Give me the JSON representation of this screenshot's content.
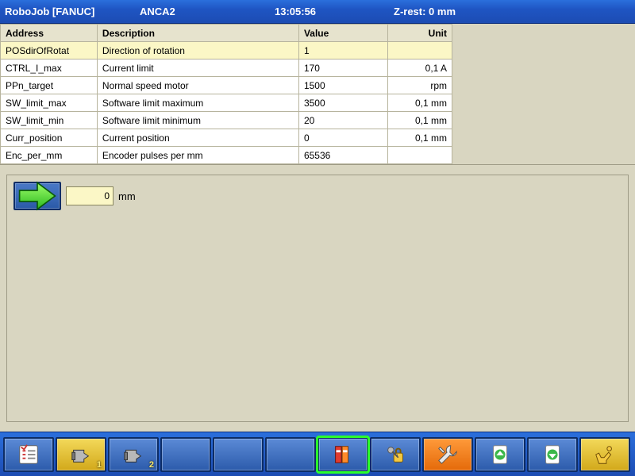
{
  "header": {
    "app": "RoboJob [FANUC]",
    "machine": "ANCA2",
    "clock": "13:05:56",
    "zrest": "Z-rest: 0 mm"
  },
  "table": {
    "columns": {
      "address": "Address",
      "description": "Description",
      "value": "Value",
      "unit": "Unit"
    },
    "rows": [
      {
        "address": "POSdirOfRotat",
        "description": "Direction of rotation",
        "value": "1",
        "unit": "",
        "selected": true
      },
      {
        "address": "CTRL_I_max",
        "description": "Current limit",
        "value": "170",
        "unit": "0,1 A",
        "selected": false
      },
      {
        "address": "PPn_target",
        "description": "Normal speed motor",
        "value": "1500",
        "unit": "rpm",
        "selected": false
      },
      {
        "address": "SW_limit_max",
        "description": "Software limit maximum",
        "value": "3500",
        "unit": "0,1 mm",
        "selected": false
      },
      {
        "address": "SW_limit_min",
        "description": "Software limit minimum",
        "value": "20",
        "unit": "0,1 mm",
        "selected": false
      },
      {
        "address": "Curr_position",
        "description": "Current position",
        "value": "0",
        "unit": "0,1 mm",
        "selected": false
      },
      {
        "address": "Enc_per_mm",
        "description": "Encoder pulses per mm",
        "value": "65536",
        "unit": "",
        "selected": false
      }
    ]
  },
  "entry": {
    "value": "0",
    "unit": "mm"
  },
  "toolbar": {
    "items": [
      {
        "name": "checklist-button",
        "icon": "checklist",
        "style": "blue",
        "badge": ""
      },
      {
        "name": "gripper-1-button",
        "icon": "gripper",
        "style": "yellow",
        "badge": "1"
      },
      {
        "name": "gripper-2-button",
        "icon": "gripper",
        "style": "blue",
        "badge": "2"
      },
      {
        "name": "empty-slot-4",
        "icon": "",
        "style": "blue",
        "badge": ""
      },
      {
        "name": "empty-slot-5",
        "icon": "",
        "style": "blue",
        "badge": ""
      },
      {
        "name": "empty-slot-6",
        "icon": "",
        "style": "blue",
        "badge": ""
      },
      {
        "name": "manual-button",
        "icon": "books",
        "style": "blue",
        "badge": "",
        "active": true
      },
      {
        "name": "security-button",
        "icon": "keylock",
        "style": "blue",
        "badge": ""
      },
      {
        "name": "tools-button",
        "icon": "wrench",
        "style": "orange",
        "badge": ""
      },
      {
        "name": "page-up-button",
        "icon": "page-up",
        "style": "blue",
        "badge": ""
      },
      {
        "name": "page-down-button",
        "icon": "page-down",
        "style": "blue",
        "badge": ""
      },
      {
        "name": "robot-button",
        "icon": "robot",
        "style": "yellow",
        "badge": ""
      }
    ]
  }
}
